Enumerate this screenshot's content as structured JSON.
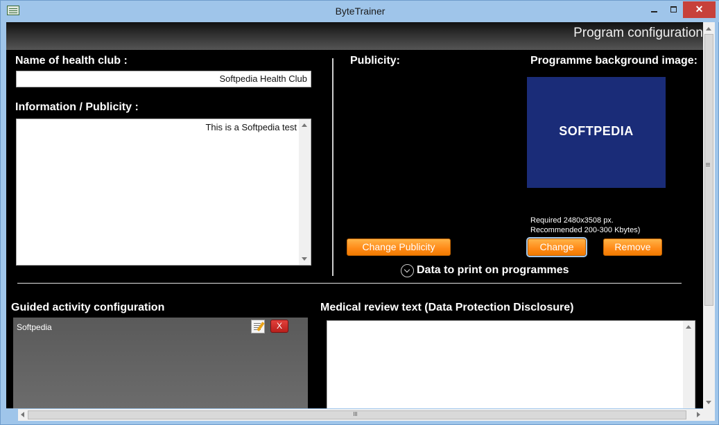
{
  "window": {
    "title": "ByteTrainer"
  },
  "header": {
    "title": "Program configuration"
  },
  "club": {
    "label": "Name of health club :",
    "value": "Softpedia Health Club"
  },
  "info": {
    "label": "Information / Publicity :",
    "value": "This is a Softpedia test"
  },
  "publicity": {
    "label": "Publicity:",
    "change_button": "Change Publicity"
  },
  "background_image": {
    "label": "Programme background image:",
    "image_text": "SOFTPEDIA",
    "note_size": "Required 2480x3508 px.",
    "note_weight": "Recommended 200-300 Kbytes)",
    "change_button": "Change",
    "remove_button": "Remove"
  },
  "expander": {
    "label": "Data to print on programmes"
  },
  "guided": {
    "label": "Guided activity configuration",
    "items": [
      {
        "name": "Softpedia"
      }
    ]
  },
  "medical": {
    "label": "Medical review text (Data Protection Disclosure)"
  },
  "icons": {
    "edit": "edit-note-icon",
    "delete": "delete-x-icon",
    "expander": "chevron-down-icon",
    "app": "app-icon"
  },
  "colors": {
    "accent": "#ff8c1a",
    "background": "#000000",
    "image_bg": "#1a2c78"
  }
}
